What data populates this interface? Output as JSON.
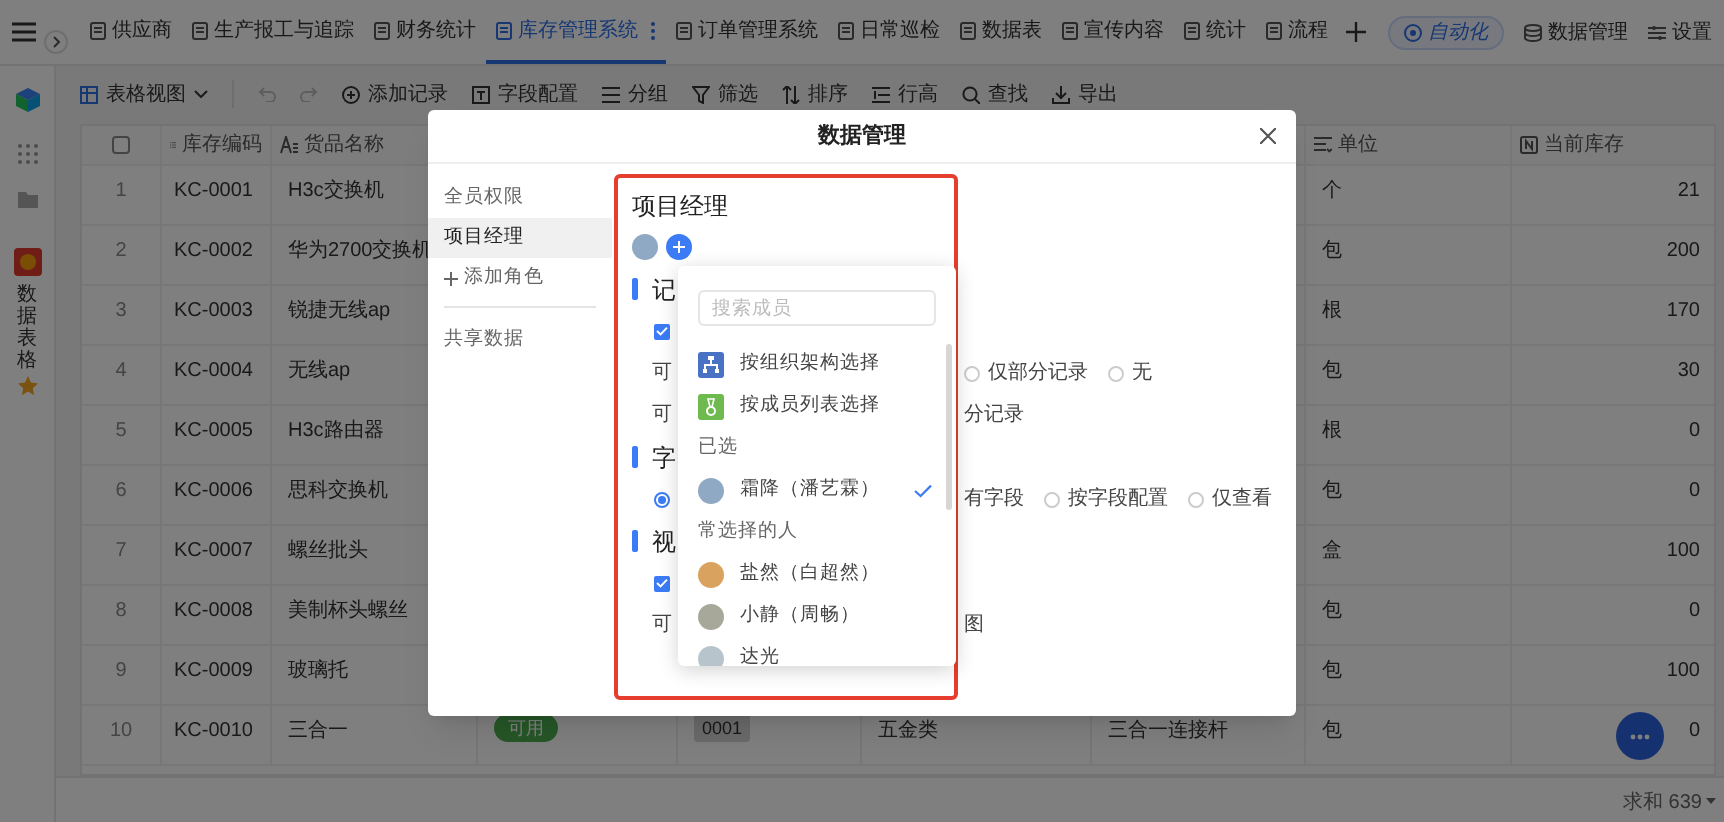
{
  "top_bar": {
    "tabs": [
      {
        "label": "供应商",
        "selected": false
      },
      {
        "label": "生产报工与追踪",
        "selected": false
      },
      {
        "label": "财务统计",
        "selected": false
      },
      {
        "label": "库存管理系统",
        "selected": true
      },
      {
        "label": "订单管理系统",
        "selected": false
      },
      {
        "label": "日常巡检",
        "selected": false
      },
      {
        "label": "数据表",
        "selected": false
      },
      {
        "label": "宣传内容",
        "selected": false
      },
      {
        "label": "统计",
        "selected": false
      },
      {
        "label": "流程",
        "selected": false
      }
    ],
    "actions": [
      {
        "label": "自动化",
        "kind": "automation"
      },
      {
        "label": "数据管理",
        "kind": "database"
      },
      {
        "label": "设置",
        "kind": "settings"
      }
    ]
  },
  "toolbar": {
    "view": "表格视图",
    "buttons": [
      {
        "label": "添加记录",
        "kind": "add"
      },
      {
        "label": "字段配置",
        "kind": "fields"
      },
      {
        "label": "分组",
        "kind": "group"
      },
      {
        "label": "筛选",
        "kind": "filter"
      },
      {
        "label": "排序",
        "kind": "sort"
      },
      {
        "label": "行高",
        "kind": "row_height"
      },
      {
        "label": "查找",
        "kind": "search"
      },
      {
        "label": "导出",
        "kind": "export"
      }
    ]
  },
  "sidebar": {
    "app_label": "数据表格"
  },
  "table": {
    "all_selected": false,
    "columns": {
      "code": "库存编码",
      "name": "货品名称",
      "unit": "单位",
      "stock": "当前库存"
    },
    "rows": [
      {
        "number": "1",
        "code": "KC-0001",
        "name": "H3c交换机",
        "unit": "个",
        "stock": "21"
      },
      {
        "number": "2",
        "code": "KC-0002",
        "name": "华为2700交换机",
        "unit": "包",
        "stock": "200"
      },
      {
        "number": "3",
        "code": "KC-0003",
        "name": "锐捷无线ap",
        "unit": "根",
        "stock": "170"
      },
      {
        "number": "4",
        "code": "KC-0004",
        "name": "无线ap",
        "unit": "包",
        "stock": "30"
      },
      {
        "number": "5",
        "code": "KC-0005",
        "name": "H3c路由器",
        "unit": "根",
        "stock": "0"
      },
      {
        "number": "6",
        "code": "KC-0006",
        "name": "思科交换机",
        "unit": "包",
        "stock": "0"
      },
      {
        "number": "7",
        "code": "KC-0007",
        "name": "螺丝批头",
        "unit": "盒",
        "stock": "100"
      },
      {
        "number": "8",
        "code": "KC-0008",
        "name": "美制杯头螺丝",
        "unit": "包",
        "stock": "0"
      },
      {
        "number": "9",
        "code": "KC-0009",
        "name": "玻璃托",
        "unit": "包",
        "stock": "100"
      },
      {
        "number": "10",
        "code": "KC-0010",
        "name": "三合一",
        "column_4": "可用",
        "column_5": "0001",
        "column_6": "五金类",
        "column_7": "三合一连接杆",
        "unit": "包",
        "stock": "0"
      }
    ],
    "footer": "求和 639"
  },
  "modal": {
    "title": "数据管理",
    "nav": {
      "roles": [
        {
          "label": "全员权限",
          "selected": false
        },
        {
          "label": "项目经理",
          "selected": true
        }
      ],
      "add_role": "添加角色",
      "shared": {
        "label": "共享数据",
        "selected": false
      }
    },
    "role": {
      "title": "项目经理",
      "rows": [
        {
          "kind": "section",
          "label": "记"
        },
        {
          "kind": "checkbox",
          "checked": true
        },
        {
          "kind": "text",
          "label": "可",
          "options": [
            {
              "label": "仅部分记录",
              "selected": false
            },
            {
              "label": "无",
              "selected": false
            }
          ]
        },
        {
          "kind": "text",
          "label": "可",
          "tail": "分记录"
        },
        {
          "kind": "section",
          "label": "字"
        },
        {
          "kind": "radio",
          "selected": true,
          "tail": "有字段",
          "options": [
            {
              "label": "按字段配置",
              "selected": false
            },
            {
              "label": "仅查看",
              "selected": false
            }
          ]
        },
        {
          "kind": "section",
          "label": "视"
        },
        {
          "kind": "checkbox",
          "checked": true
        },
        {
          "kind": "text",
          "label": "可",
          "tail": "图"
        }
      ]
    },
    "picker": {
      "placeholder": "搜索成员",
      "methods": [
        {
          "label": "按组织架构选择",
          "kind": "org"
        },
        {
          "label": "按成员列表选择",
          "kind": "list"
        }
      ],
      "groups": [
        {
          "title": "已选",
          "members": [
            {
              "name": "霜降（潘艺霖）",
              "selected": true
            }
          ]
        },
        {
          "title": "常选择的人",
          "members": [
            {
              "name": "盐然（白超然）",
              "selected": false
            },
            {
              "name": "小静（周畅）",
              "selected": false
            },
            {
              "name": "达光",
              "selected": false
            }
          ]
        }
      ]
    }
  }
}
